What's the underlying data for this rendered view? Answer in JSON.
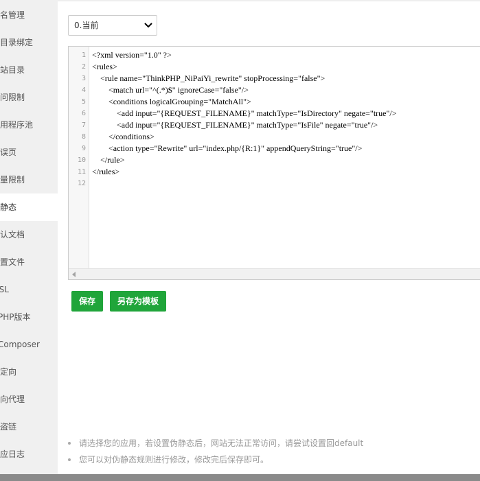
{
  "sidebar": {
    "items": [
      {
        "label": "域名管理"
      },
      {
        "label": "子目录绑定"
      },
      {
        "label": "网站目录"
      },
      {
        "label": "访问限制"
      },
      {
        "label": "应用程序池"
      },
      {
        "label": "错误页"
      },
      {
        "label": "流量限制"
      },
      {
        "label": "伪静态",
        "active": true
      },
      {
        "label": "默认文档"
      },
      {
        "label": "配置文件"
      },
      {
        "label": "SSL"
      },
      {
        "label": "PHP版本"
      },
      {
        "label": "Composer"
      },
      {
        "label": "重定向"
      },
      {
        "label": "反向代理"
      },
      {
        "label": "防盗链"
      },
      {
        "label": "响应日志"
      }
    ]
  },
  "version_select": {
    "selected": "0.当前"
  },
  "editor": {
    "line_numbers": [
      "1",
      "2",
      "3",
      "4",
      "5",
      "6",
      "7",
      "8",
      "9",
      "10",
      "11",
      "12"
    ],
    "lines": [
      "<?xml version=\"1.0\" ?>",
      "<rules>",
      "    <rule name=\"ThinkPHP_NiPaiYi_rewrite\" stopProcessing=\"false\">",
      "        <match url=\"^(.*)$\" ignoreCase=\"false\"/>",
      "        <conditions logicalGrouping=\"MatchAll\">",
      "            <add input=\"{REQUEST_FILENAME}\" matchType=\"IsDirectory\" negate=\"true\"/>",
      "            <add input=\"{REQUEST_FILENAME}\" matchType=\"IsFile\" negate=\"true\"/>",
      "        </conditions>",
      "        <action type=\"Rewrite\" url=\"index.php/{R:1}\" appendQueryString=\"true\"/>",
      "    </rule>",
      "</rules>",
      ""
    ]
  },
  "buttons": {
    "save": "保存",
    "save_as_template": "另存为模板"
  },
  "tips": [
    "请选择您的应用，若设置伪静态后，网站无法正常访问，请尝试设置回default",
    "您可以对伪静态规则进行修改，修改完后保存即可。"
  ],
  "colors": {
    "accent": "#20a53a",
    "sidebar_bg": "#f0f0f0"
  }
}
